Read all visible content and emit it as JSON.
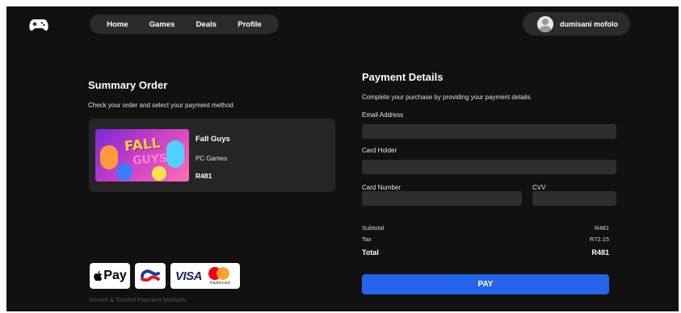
{
  "nav": {
    "items": [
      {
        "label": "Home"
      },
      {
        "label": "Games"
      },
      {
        "label": "Deals"
      },
      {
        "label": "Profile"
      }
    ]
  },
  "user": {
    "name": "dumisani mofolo",
    "avatar_icon": "user-avatar-icon"
  },
  "logo_icon": "gamepad-icon",
  "summary": {
    "title": "Summary Order",
    "subtitle": "Check your order and select your payment method",
    "item": {
      "name": "Fall Guys",
      "thumb_line1": "FALL",
      "thumb_line2": "GUYS",
      "platform": "PC Games",
      "price": "R481"
    }
  },
  "payment_methods": {
    "apple_pay": "Pay",
    "visa": "VISA",
    "mastercard": "mastercard",
    "caption": "Secure & Trusted Payment Methods"
  },
  "payment": {
    "title": "Payment Details",
    "subtitle": "Complete your purchase by providing your payment details.",
    "fields": {
      "email": {
        "label": "Email Address",
        "value": ""
      },
      "holder": {
        "label": "Card Holder",
        "value": ""
      },
      "number": {
        "label": "Card Number",
        "value": ""
      },
      "cvv": {
        "label": "CVV",
        "value": ""
      }
    },
    "totals": {
      "subtotal_label": "Subtotal",
      "subtotal": "R481",
      "tax_label": "Tax",
      "tax": "R72.15",
      "total_label": "Total",
      "total": "R481"
    },
    "pay_label": "PAY"
  },
  "colors": {
    "background": "#111111",
    "panel": "#252525",
    "input": "#2e2e2e",
    "accent": "#2563eb"
  }
}
